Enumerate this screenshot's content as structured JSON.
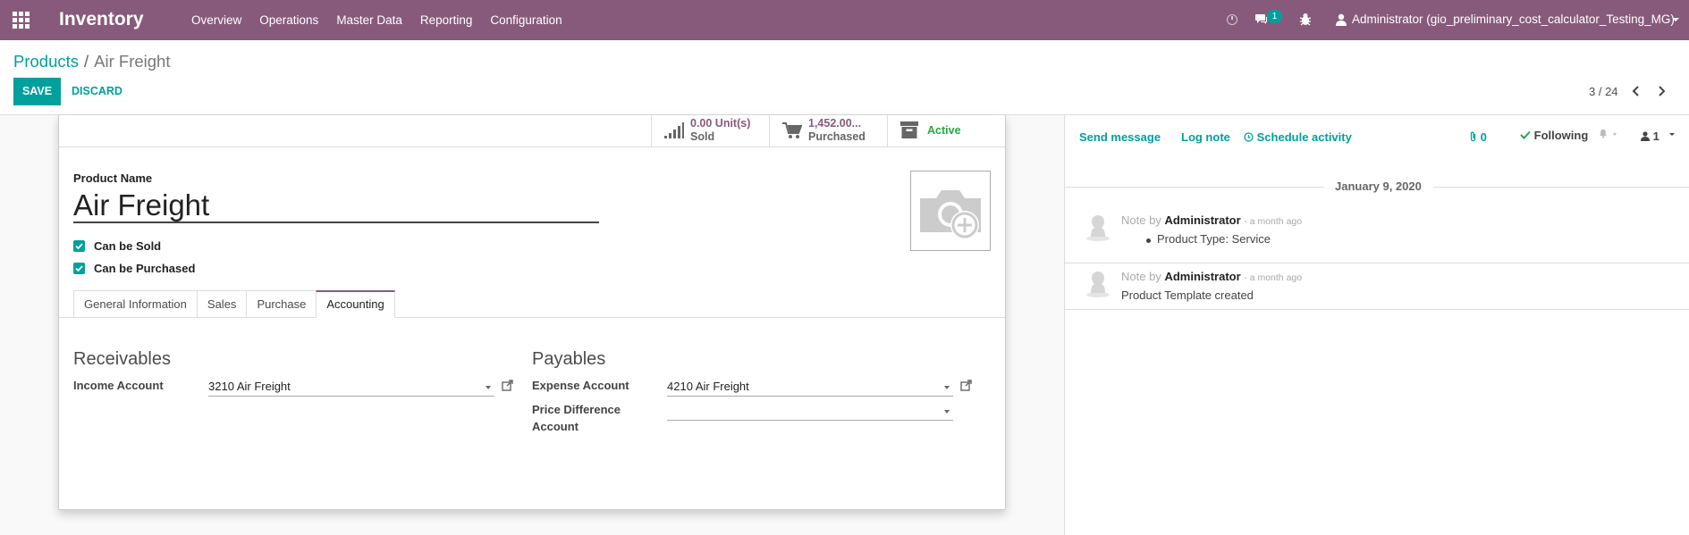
{
  "navbar": {
    "app_title": "Inventory",
    "menu": [
      "Overview",
      "Operations",
      "Master Data",
      "Reporting",
      "Configuration"
    ],
    "chat_count": "1",
    "user": "Administrator (gio_preliminary_cost_calculator_Testing_MG)",
    "color": "#875a7b"
  },
  "control_panel": {
    "breadcrumb_root": "Products",
    "breadcrumb_sep": "/",
    "breadcrumb_current": "Air Freight",
    "save_label": "SAVE",
    "discard_label": "DISCARD",
    "pager": "3 / 24"
  },
  "smart_buttons": {
    "sold_value": "0.00 Unit(s)",
    "sold_label": "Sold",
    "purchased_value": "1,452.00...",
    "purchased_label": "Purchased",
    "active_label": "Active"
  },
  "product": {
    "name_label": "Product Name",
    "name": "Air Freight",
    "can_be_sold_label": "Can be Sold",
    "can_be_sold": true,
    "can_be_purchased_label": "Can be Purchased",
    "can_be_purchased": true
  },
  "tabs": [
    "General Information",
    "Sales",
    "Purchase",
    "Accounting"
  ],
  "active_tab": "Accounting",
  "accounting": {
    "receivables_title": "Receivables",
    "income_label": "Income Account",
    "income_value": "3210 Air Freight",
    "payables_title": "Payables",
    "expense_label": "Expense Account",
    "expense_value": "4210 Air Freight",
    "price_diff_label_1": "Price Difference",
    "price_diff_label_2": "Account",
    "price_diff_value": ""
  },
  "chatter": {
    "send_message": "Send message",
    "log_note": "Log note",
    "schedule_activity": "Schedule activity",
    "attachments": "0",
    "following": "Following",
    "followers": "1",
    "date": "January 9, 2020",
    "messages": [
      {
        "prefix": "Note by",
        "author": "Administrator",
        "time": "- a month ago",
        "body": "Product Type: Service"
      },
      {
        "prefix": "Note by",
        "author": "Administrator",
        "time": "- a month ago",
        "body": "Product Template created"
      }
    ]
  },
  "colors": {
    "accent": "#00a09d",
    "brand": "#875a7b",
    "active": "#28a745"
  }
}
